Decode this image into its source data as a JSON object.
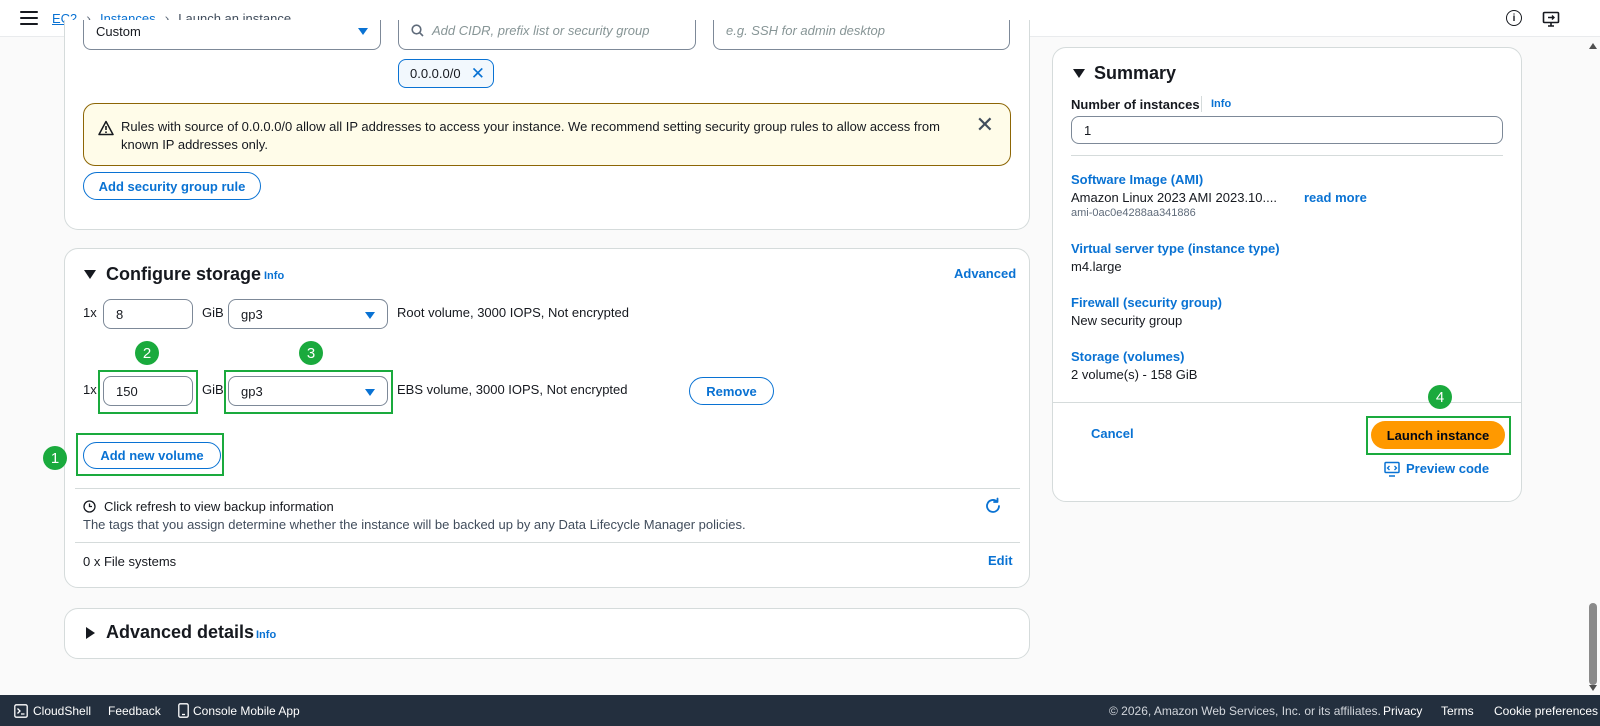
{
  "breadcrumb": {
    "items": [
      "EC2",
      "Instances"
    ],
    "current": "Launch an instance"
  },
  "security_rule": {
    "type_value": "Custom",
    "source_placeholder": "Add CIDR, prefix list or security group",
    "description_placeholder": "e.g. SSH for admin desktop",
    "token": "0.0.0.0/0",
    "alert_text": "Rules with source of 0.0.0.0/0 allow all IP addresses to access your instance. We recommend setting security group rules to allow access from known IP addresses only.",
    "add_rule_button": "Add security group rule"
  },
  "storage": {
    "title": "Configure storage",
    "info": "Info",
    "advanced": "Advanced",
    "volumes": [
      {
        "prefix": "1x",
        "size": "8",
        "unit": "GiB",
        "type": "gp3",
        "desc": "Root volume,  3000 IOPS,  Not encrypted"
      },
      {
        "prefix": "1x",
        "size": "150",
        "unit": "GiB",
        "type": "gp3",
        "desc": "EBS volume,  3000 IOPS,  Not encrypted",
        "remove": "Remove"
      }
    ],
    "add_volume": "Add new volume",
    "backup_title": "Click refresh to view backup information",
    "backup_desc": "The tags that you assign determine whether the instance will be backed up by any Data Lifecycle Manager policies.",
    "file_systems": "0 x File systems",
    "edit": "Edit"
  },
  "advanced_details": {
    "title": "Advanced details",
    "info": "Info"
  },
  "summary": {
    "title": "Summary",
    "num_label": "Number of instances",
    "info": "Info",
    "num_value": "1",
    "ami_label": "Software Image (AMI)",
    "ami_value": "Amazon Linux 2023 AMI 2023.10....",
    "ami_more": "read more",
    "ami_id": "ami-0ac0e4288aa341886",
    "type_label": "Virtual server type (instance type)",
    "type_value": "m4.large",
    "fw_label": "Firewall (security group)",
    "fw_value": "New security group",
    "storage_label": "Storage (volumes)",
    "storage_value": "2 volume(s) - 158 GiB",
    "cancel": "Cancel",
    "launch": "Launch instance",
    "preview": "Preview code"
  },
  "annotations": [
    "1",
    "2",
    "3",
    "4"
  ],
  "footer": {
    "cloudshell": "CloudShell",
    "feedback": "Feedback",
    "mobile": "Console Mobile App",
    "copyright": "© 2026, Amazon Web Services, Inc. or its affiliates.",
    "privacy": "Privacy",
    "terms": "Terms",
    "cookies": "Cookie preferences"
  },
  "colors": {
    "link": "#0972d3",
    "primary": "#ff9900",
    "highlight": "#1aaa3d",
    "footer_bg": "#232f3e"
  }
}
